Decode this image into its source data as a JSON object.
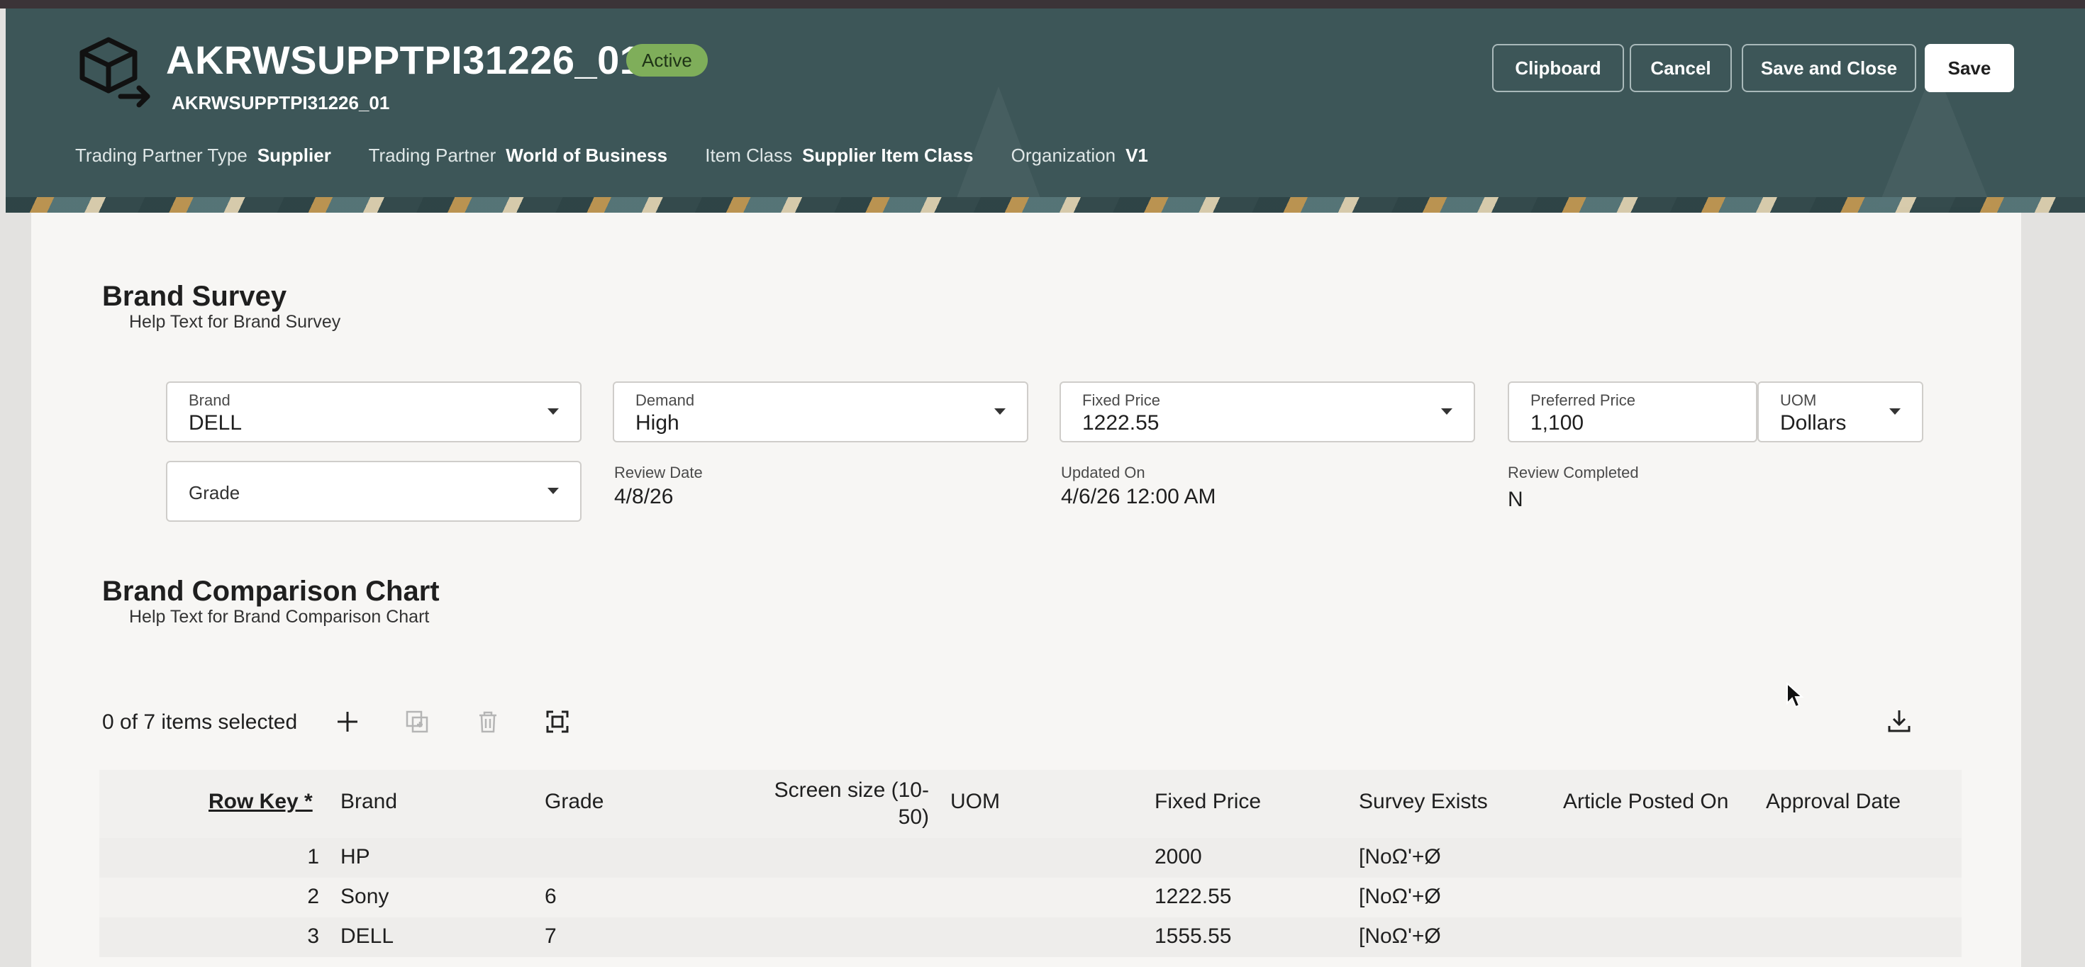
{
  "header": {
    "title": "AKRWSUPPTPI31226_01",
    "status": "Active",
    "subtitle": "AKRWSUPPTPI31226_01",
    "meta": [
      {
        "label": "Trading Partner Type",
        "value": "Supplier"
      },
      {
        "label": "Trading Partner",
        "value": "World of Business"
      },
      {
        "label": "Item Class",
        "value": "Supplier Item Class"
      },
      {
        "label": "Organization",
        "value": "V1"
      }
    ],
    "buttons": {
      "clipboard": "Clipboard",
      "cancel": "Cancel",
      "save_close": "Save and Close",
      "save": "Save"
    },
    "colors": {
      "header_bg": "#3d5658",
      "badge_bg": "#7fae5a"
    }
  },
  "brand_survey": {
    "title": "Brand Survey",
    "help": "Help Text for Brand Survey",
    "brand": {
      "label": "Brand",
      "value": "DELL"
    },
    "demand": {
      "label": "Demand",
      "value": "High"
    },
    "fixed_price": {
      "label": "Fixed Price",
      "value": "1222.55"
    },
    "preferred_price": {
      "label": "Preferred Price",
      "value": "1,100"
    },
    "uom": {
      "label": "UOM",
      "value": "Dollars"
    },
    "grade": {
      "placeholder": "Grade"
    },
    "review_date": {
      "label": "Review Date",
      "value": "4/8/26"
    },
    "updated_on": {
      "label": "Updated On",
      "value": "4/6/26 12:00 AM"
    },
    "review_completed": {
      "label": "Review Completed",
      "value": "N"
    }
  },
  "comparison": {
    "title": "Brand Comparison Chart",
    "help": "Help Text for Brand Comparison Chart",
    "selection": "0 of 7 items selected",
    "icons": [
      "plus-icon",
      "duplicate-icon",
      "trash-icon",
      "fit-icon",
      "download-icon"
    ],
    "columns": {
      "row_key": "Row Key *",
      "brand": "Brand",
      "grade": "Grade",
      "screen_size_1": "Screen size (10-",
      "screen_size_2": "50)",
      "uom": "UOM",
      "fixed_price": "Fixed Price",
      "survey_exists": "Survey Exists",
      "article_posted": "Article Posted On",
      "approval_date": "Approval Date"
    },
    "rows": [
      {
        "row_key": "1",
        "brand": "HP",
        "grade": "",
        "screen": "",
        "uom": "",
        "fixed_price": "2000",
        "survey": "[NoΩ'+Ø"
      },
      {
        "row_key": "2",
        "brand": "Sony",
        "grade": "6",
        "screen": "",
        "uom": "",
        "fixed_price": "1222.55",
        "survey": "[NoΩ'+Ø"
      },
      {
        "row_key": "3",
        "brand": "DELL",
        "grade": "7",
        "screen": "",
        "uom": "",
        "fixed_price": "1555.55",
        "survey": "[NoΩ'+Ø"
      }
    ]
  }
}
